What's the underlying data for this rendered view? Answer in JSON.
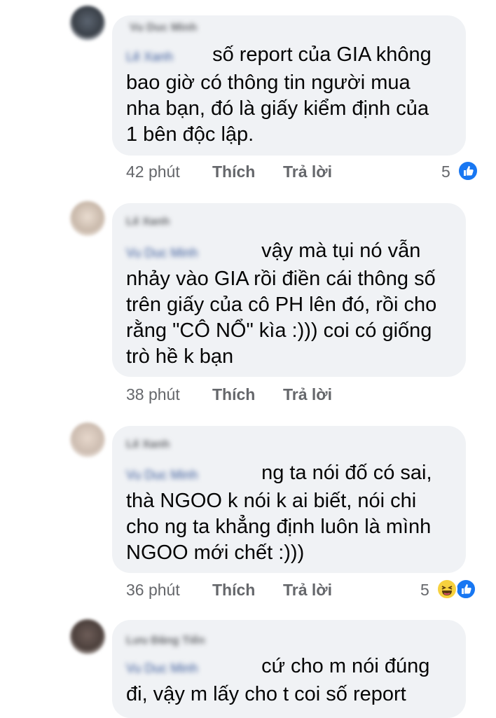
{
  "comments": [
    {
      "author": "Vu Duc Minh",
      "tag": "Lê Xanh",
      "lines": [
        "số report của GIA không",
        "bao giờ có thông tin người mua",
        "nha bạn, đó là giấy kiểm định của",
        "1 bên độc lập."
      ],
      "time": "42 phút",
      "like_label": "Thích",
      "reply_label": "Trả lời",
      "reaction_count": "5",
      "reactions": [
        "like-icon"
      ]
    },
    {
      "author": "Lê Xanh",
      "tag": "Vu Duc Minh",
      "lines": [
        "vậy mà tụi nó vẫn",
        "nhảy vào GIA rồi điền cái thông số",
        "trên giấy của cô PH lên đó, rồi cho",
        "rằng \"CÔ NỔ\" kìa :))) coi có giống",
        "trò hề k bạn"
      ],
      "time": "38 phút",
      "like_label": "Thích",
      "reply_label": "Trả lời"
    },
    {
      "author": "Lê Xanh",
      "tag": "Vu Duc Minh",
      "lines": [
        "ng ta nói đố có sai,",
        "thà NGOO k nói k ai biết, nói chi",
        "cho ng ta khẳng định luôn là mình",
        "NGOO mới chết :)))"
      ],
      "time": "36 phút",
      "like_label": "Thích",
      "reply_label": "Trả lời",
      "reaction_count": "5",
      "reactions": [
        "haha-icon",
        "like-icon"
      ]
    },
    {
      "author": "Lưu Đăng Tiến",
      "tag": "Vu Duc Minh",
      "lines": [
        "cứ cho m nói đúng",
        "đi, vậy m lấy cho t coi số report"
      ]
    }
  ],
  "colors": {
    "bubble": "#f0f2f5",
    "meta_text": "#65676b",
    "like_blue": "#1877f2",
    "haha_yellow": "#f7d13e",
    "tag_blue": "#385898"
  }
}
